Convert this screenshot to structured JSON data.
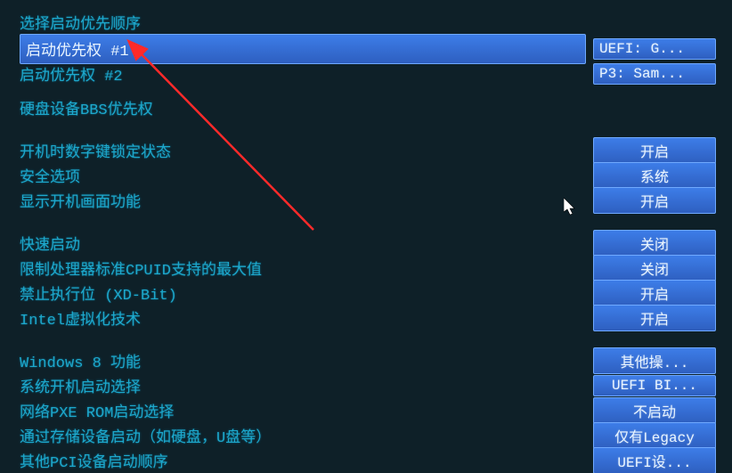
{
  "title": "选择启动优先顺序",
  "boot": {
    "priority1_label": "启动优先权 #1",
    "priority1_value": "UEFI: G...",
    "priority2_label": "启动优先权 #2",
    "priority2_value": "P3: Sam...",
    "hdd_bbs_label": "硬盘设备BBS优先权"
  },
  "settings1": [
    {
      "label": "开机时数字键锁定状态",
      "value": "开启"
    },
    {
      "label": "安全选项",
      "value": "系统"
    },
    {
      "label": "显示开机画面功能",
      "value": "开启"
    }
  ],
  "settings2": [
    {
      "label": "快速启动",
      "value": "关闭"
    },
    {
      "label": "限制处理器标准CPUID支持的最大值",
      "value": "关闭"
    },
    {
      "label": "禁止执行位 (XD-Bit)",
      "value": "开启"
    },
    {
      "label": "Intel虚拟化技术",
      "value": "开启"
    }
  ],
  "settings3": [
    {
      "label": "Windows 8 功能",
      "value": "其他操..."
    },
    {
      "label": "系统开机启动选择",
      "value": "UEFI BI..."
    },
    {
      "label": "网络PXE ROM启动选择",
      "value": "不启动"
    },
    {
      "label": "通过存储设备启动（如硬盘，U盘等）",
      "value": "仅有Legacy"
    },
    {
      "label": "其他PCI设备启动顺序",
      "value": "UEFI设..."
    }
  ]
}
